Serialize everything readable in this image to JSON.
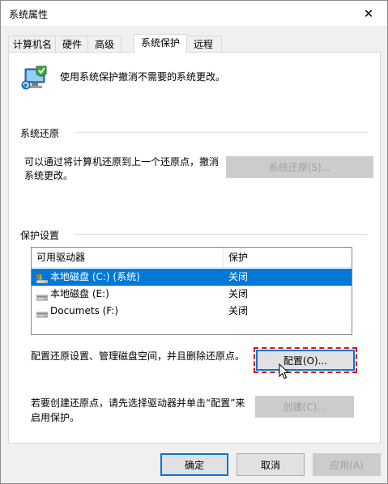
{
  "window": {
    "title": "系统属性",
    "close_glyph": "✕"
  },
  "tabs": [
    {
      "label": "计算机名",
      "active": false
    },
    {
      "label": "硬件",
      "active": false
    },
    {
      "label": "高级",
      "active": false
    },
    {
      "label": "系统保护",
      "active": true
    },
    {
      "label": "远程",
      "active": false
    }
  ],
  "intro": {
    "text": "使用系统保护撤消不需要的系统更改。",
    "icon": "system-protection-icon"
  },
  "restore": {
    "group_title": "系统还原",
    "description_line1": "可以通过将计算机还原到上一个还原点，撤消",
    "description_line2": "系统更改。",
    "button_label": "系统还原(S)..."
  },
  "protection": {
    "group_title": "保护设置",
    "columns": [
      "可用驱动器",
      "保护"
    ],
    "drives": [
      {
        "name": "本地磁盘 (C:) (系统)",
        "protection": "关闭",
        "selected": true,
        "icon": "system-drive-icon"
      },
      {
        "name": "本地磁盘 (E:)",
        "protection": "关闭",
        "selected": false,
        "icon": "drive-icon"
      },
      {
        "name": "Documets (F:)",
        "protection": "关闭",
        "selected": false,
        "icon": "drive-icon"
      }
    ],
    "configure_text": "配置还原设置、管理磁盘空间，并且删除还原点。",
    "configure_button": "配置(O)...",
    "create_text_line1": "若要创建还原点，请先选择驱动器并单击“配置”来",
    "create_text_line2": "启用保护。",
    "create_button": "创建(C)..."
  },
  "footer": {
    "ok": "确定",
    "cancel": "取消",
    "apply": "应用(A)"
  },
  "colors": {
    "selection": "#0078d7",
    "highlight_outline": "#d5141e"
  }
}
